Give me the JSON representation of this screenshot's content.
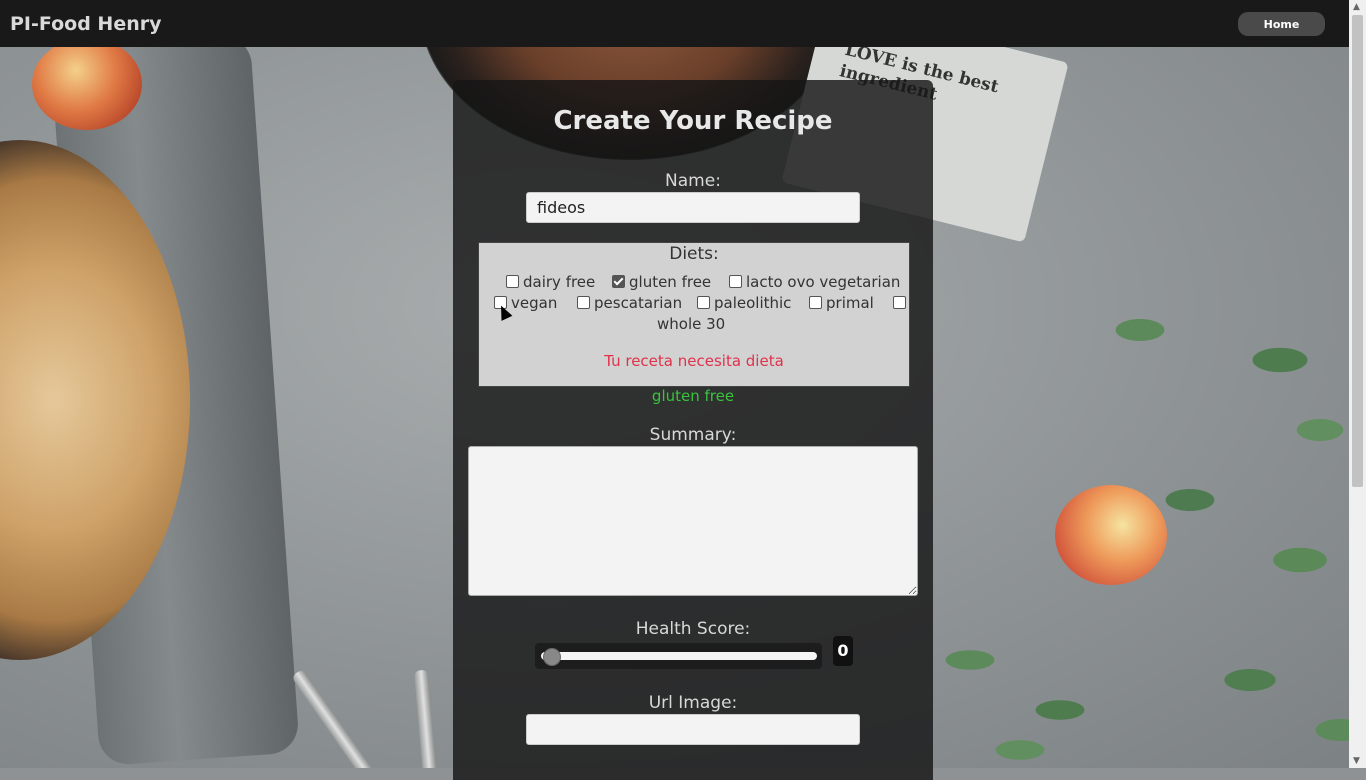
{
  "navbar": {
    "brand": "PI-Food Henry",
    "home_label": "Home"
  },
  "background": {
    "paper_text": "LOVE is the best ingredient"
  },
  "form": {
    "title": "Create Your Recipe",
    "name_label": "Name:",
    "name_value": "fideos",
    "diets_label": "Diets:",
    "diets": [
      {
        "label": "dairy free",
        "checked": false
      },
      {
        "label": "gluten free",
        "checked": true
      },
      {
        "label": "lacto ovo vegetarian",
        "checked": false
      },
      {
        "label": "vegan",
        "checked": false
      },
      {
        "label": "pescatarian",
        "checked": false
      },
      {
        "label": "paleolithic",
        "checked": false
      },
      {
        "label": "primal",
        "checked": false
      },
      {
        "label": "whole 30",
        "checked": false
      }
    ],
    "diets_error": "Tu receta necesita dieta",
    "selected_diets": "gluten free",
    "summary_label": "Summary:",
    "summary_value": "",
    "health_label": "Health Score:",
    "health_value": "0",
    "url_label": "Url Image:",
    "url_value": ""
  },
  "colors": {
    "navbar_bg": "#191919",
    "panel_bg": "#161616",
    "error": "#e0324b",
    "success": "#39c43c"
  }
}
